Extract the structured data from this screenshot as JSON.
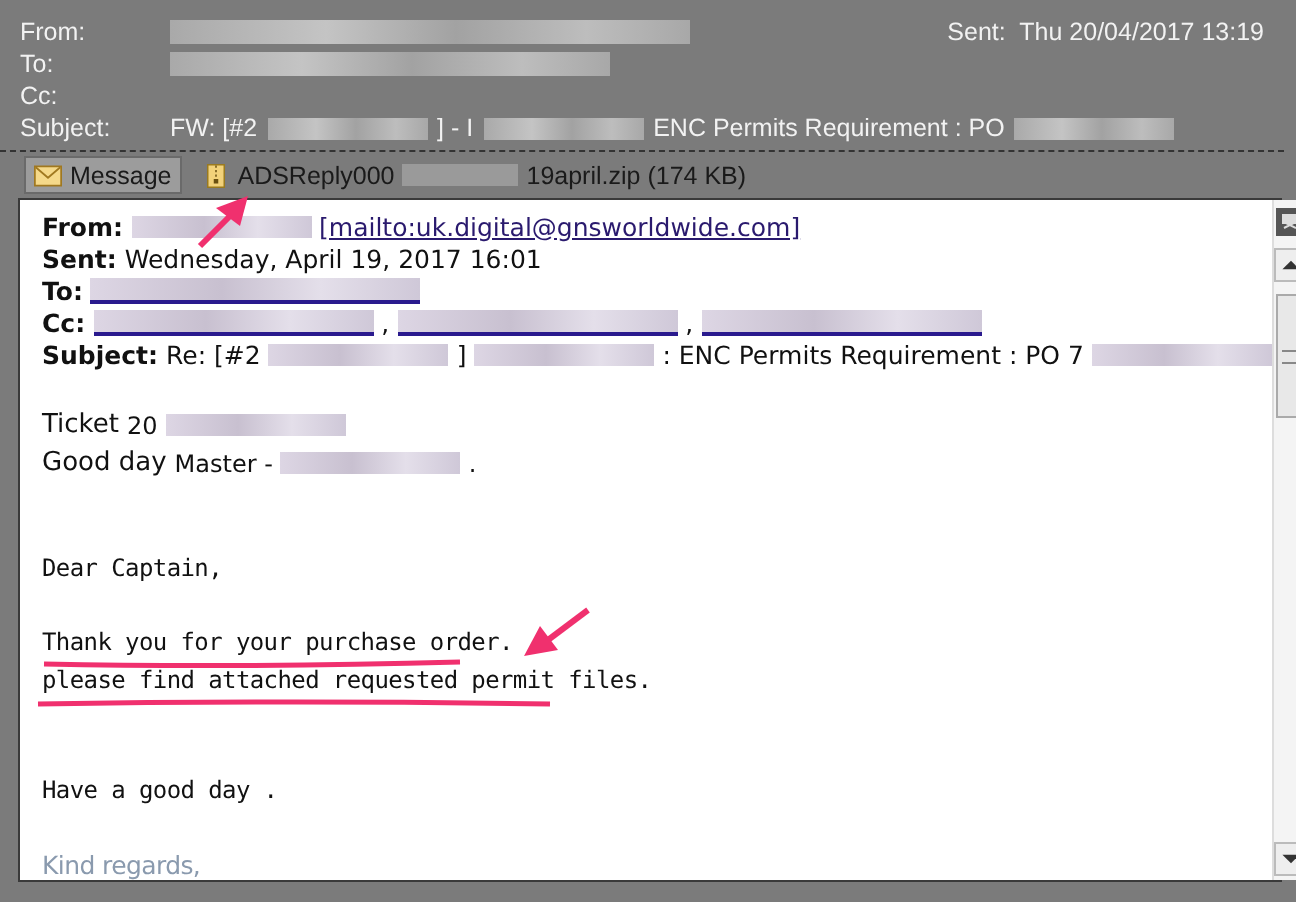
{
  "header": {
    "fields": [
      {
        "label": "From:",
        "parts": [
          {
            "kind": "blur"
          }
        ]
      },
      {
        "label": "To:",
        "parts": [
          {
            "kind": "blur"
          }
        ]
      },
      {
        "label": "Cc:"
      },
      {
        "label": "Subject:",
        "parts": [
          {
            "kind": "text",
            "text": "FW: [#2"
          },
          {
            "kind": "blur"
          },
          {
            "kind": "text",
            "text": "] - I"
          },
          {
            "kind": "blur"
          },
          {
            "kind": "text",
            "text": "ENC Permits Requirement : PO"
          },
          {
            "kind": "blur"
          }
        ]
      }
    ],
    "sent_label": "Sent:",
    "sent_value": "Thu 20/04/2017 13:19"
  },
  "attachments": [
    {
      "kind": "message",
      "label": "Message",
      "selected": true
    },
    {
      "kind": "zip",
      "parts": [
        {
          "kind": "text",
          "text": "ADSReply000"
        },
        {
          "kind": "blur"
        },
        {
          "kind": "text",
          "text": "19april.zip (174 KB)"
        }
      ],
      "selected": false
    }
  ],
  "body": {
    "lines": [
      {
        "kind": "header",
        "label": "From:",
        "parts": [
          {
            "kind": "blur"
          },
          {
            "kind": "link",
            "text": "[mailto:uk.digital@gnsworldwide.com]"
          }
        ]
      },
      {
        "kind": "header",
        "label": "Sent:",
        "parts": [
          {
            "kind": "text",
            "text": "Wednesday, April 19, 2017 16:01"
          }
        ]
      },
      {
        "kind": "header",
        "label": "To:",
        "parts": [
          {
            "kind": "blurlink"
          }
        ]
      },
      {
        "kind": "header",
        "label": "Cc:",
        "parts": [
          {
            "kind": "blurlink"
          },
          {
            "kind": "text",
            "text": ","
          },
          {
            "kind": "blurlink"
          },
          {
            "kind": "text",
            "text": ","
          },
          {
            "kind": "blurlink"
          }
        ]
      },
      {
        "kind": "header",
        "label": "Subject:",
        "parts": [
          {
            "kind": "text",
            "text": "Re: [#2"
          },
          {
            "kind": "blur"
          },
          {
            "kind": "text",
            "text": "]"
          },
          {
            "kind": "blur"
          },
          {
            "kind": "text",
            "text": ": ENC Permits Requirement : PO 7"
          },
          {
            "kind": "blur"
          }
        ]
      },
      {
        "kind": "blank"
      },
      {
        "kind": "greeting",
        "label": "Ticket",
        "parts": [
          {
            "kind": "text",
            "text": "20"
          },
          {
            "kind": "blur"
          }
        ]
      },
      {
        "kind": "greeting",
        "label": "Good day",
        "parts": [
          {
            "kind": "text",
            "text": "Master -"
          },
          {
            "kind": "blur"
          },
          {
            "kind": "text",
            "text": "."
          }
        ]
      },
      {
        "kind": "blank"
      },
      {
        "kind": "blank"
      },
      {
        "kind": "text",
        "text": "Dear Captain,"
      },
      {
        "kind": "blank"
      },
      {
        "kind": "text",
        "text": "Thank you for your purchase order."
      },
      {
        "kind": "text",
        "text": "please find attached requested permit files."
      },
      {
        "kind": "blank"
      },
      {
        "kind": "blank"
      },
      {
        "kind": "text",
        "text": "Have a good day ."
      },
      {
        "kind": "blank"
      },
      {
        "kind": "signature",
        "text": "Kind regards,"
      }
    ]
  }
}
